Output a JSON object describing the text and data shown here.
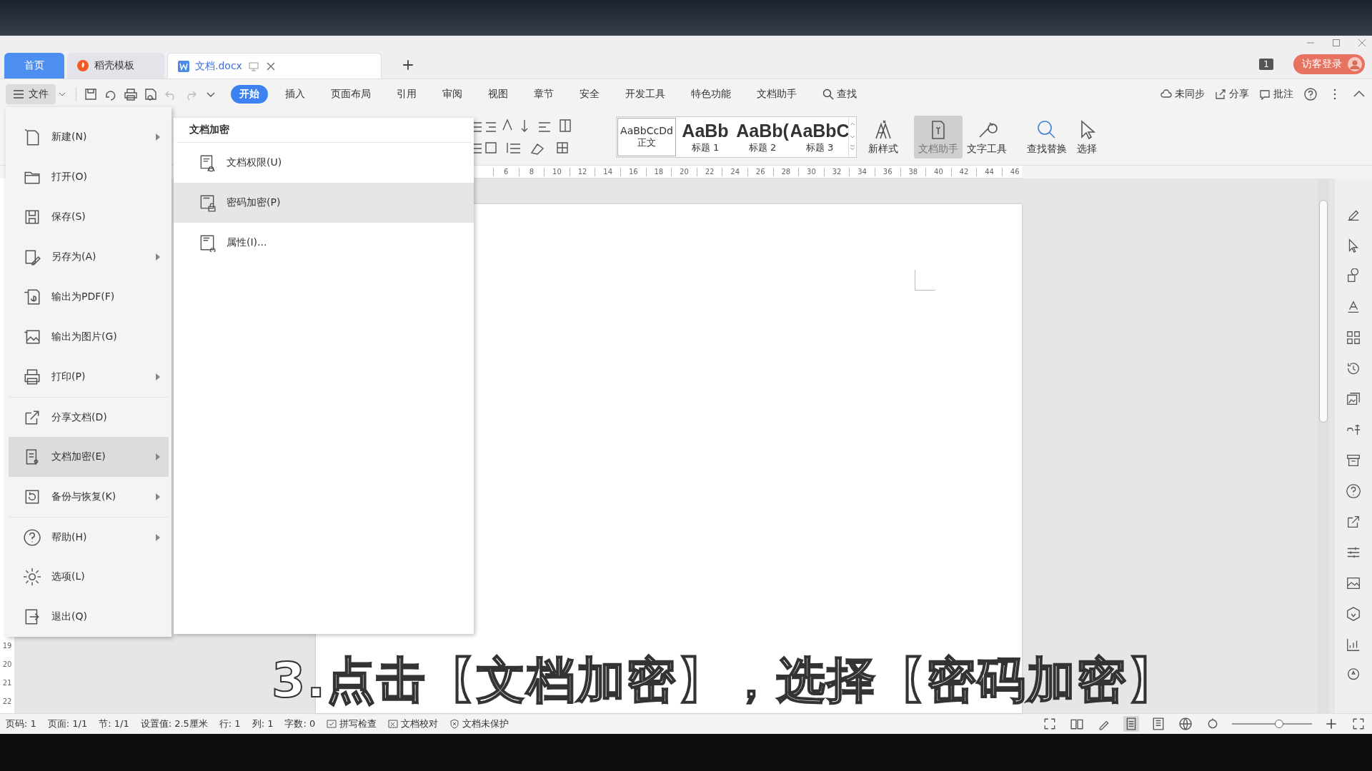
{
  "tabs": [
    {
      "label": "首页",
      "kind": "home",
      "selected": false
    },
    {
      "label": "稻壳模板",
      "kind": "template",
      "selected": false
    },
    {
      "label": "文档.docx",
      "kind": "doc",
      "selected": true
    }
  ],
  "account": {
    "count": "1",
    "login": "访客登录"
  },
  "file_button": "文件",
  "menu_tabs": [
    {
      "label": "开始",
      "selected": true
    },
    {
      "label": "插入",
      "selected": false
    },
    {
      "label": "页面布局",
      "selected": false
    },
    {
      "label": "引用",
      "selected": false
    },
    {
      "label": "审阅",
      "selected": false
    },
    {
      "label": "视图",
      "selected": false
    },
    {
      "label": "章节",
      "selected": false
    },
    {
      "label": "安全",
      "selected": false
    },
    {
      "label": "开发工具",
      "selected": false
    },
    {
      "label": "特色功能",
      "selected": false
    },
    {
      "label": "文档助手",
      "selected": false
    },
    {
      "label": "查找",
      "selected": false
    }
  ],
  "top_actions": [
    "未同步",
    "分享",
    "批注"
  ],
  "styles": [
    {
      "sample": "AaBbCcDd",
      "label": "正文"
    },
    {
      "sample": "AaBb",
      "label": "标题 1"
    },
    {
      "sample": "AaBb(",
      "label": "标题 2"
    },
    {
      "sample": "AaBbC",
      "label": "标题 3"
    }
  ],
  "ribbon_tools": [
    {
      "label": "新样式",
      "active": false
    },
    {
      "label": "文档助手",
      "active": true
    },
    {
      "label": "文字工具",
      "active": false
    },
    {
      "label": "查找替换",
      "active": false
    },
    {
      "label": "选择",
      "active": false
    }
  ],
  "ruler_marks": [
    "6",
    "8",
    "10",
    "12",
    "14",
    "16",
    "18",
    "20",
    "22",
    "24",
    "26",
    "28",
    "30",
    "32",
    "34",
    "36",
    "38",
    "40",
    "42",
    "44",
    "46"
  ],
  "vertical_ruler": [
    "19",
    "20",
    "21",
    "22"
  ],
  "file_menu": [
    {
      "label": "新建(N)",
      "submenu": true,
      "selected": false
    },
    {
      "label": "打开(O)",
      "submenu": false,
      "selected": false
    },
    {
      "label": "保存(S)",
      "submenu": false,
      "selected": false
    },
    {
      "label": "另存为(A)",
      "submenu": true,
      "selected": false
    },
    {
      "label": "输出为PDF(F)",
      "submenu": false,
      "selected": false
    },
    {
      "label": "输出为图片(G)",
      "submenu": false,
      "selected": false
    },
    {
      "label": "打印(P)",
      "submenu": true,
      "selected": false
    },
    {
      "label": "分享文档(D)",
      "submenu": false,
      "selected": false
    },
    {
      "label": "文档加密(E)",
      "submenu": true,
      "selected": true
    },
    {
      "label": "备份与恢复(K)",
      "submenu": true,
      "selected": false
    },
    {
      "label": "帮助(H)",
      "submenu": true,
      "selected": false
    },
    {
      "label": "选项(L)",
      "submenu": false,
      "selected": false
    },
    {
      "label": "退出(Q)",
      "submenu": false,
      "selected": false
    }
  ],
  "submenu": {
    "title": "文档加密",
    "items": [
      {
        "label": "文档权限(U)",
        "selected": false
      },
      {
        "label": "密码加密(P)",
        "selected": true
      },
      {
        "label": "属性(I)...",
        "selected": false
      }
    ]
  },
  "caption": "3.点击【文档加密】，选择【密码加密】",
  "status_bar": {
    "zoom_slider": {
      "level": 0.6
    },
    "fields": [
      "页码: 1",
      "页面: 1/1",
      "节: 1/1",
      "设置值: 2.5厘米",
      "行: 1",
      "列: 1",
      "字数: 0"
    ],
    "toggles": [
      "拼写检查",
      "文档校对",
      "文档未保护"
    ]
  }
}
